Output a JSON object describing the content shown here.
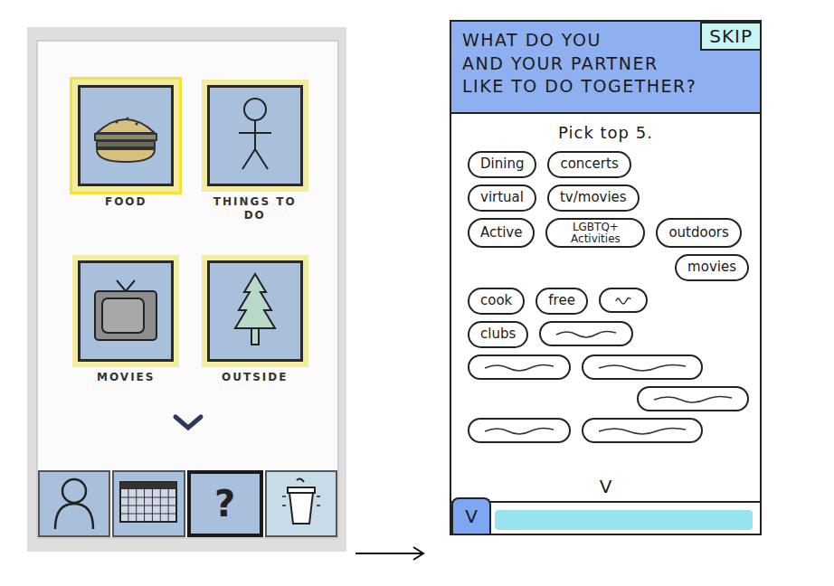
{
  "left": {
    "tiles": [
      {
        "label": "FOOD",
        "kind": "food",
        "selected": true
      },
      {
        "label": "THINGS TO DO",
        "kind": "person",
        "selected": false
      },
      {
        "label": "MOVIES",
        "kind": "tv",
        "selected": false
      },
      {
        "label": "OUTSIDE",
        "kind": "tree",
        "selected": false
      }
    ],
    "nav": [
      {
        "kind": "profile",
        "selected": false
      },
      {
        "kind": "calendar",
        "selected": false
      },
      {
        "kind": "help",
        "label": "?",
        "selected": true
      },
      {
        "kind": "drink",
        "selected": false
      }
    ]
  },
  "right": {
    "title_lines": [
      "WHAT DO YOU",
      "AND YOUR PARTNER",
      "LIKE TO DO TOGETHER?"
    ],
    "skip": "SKIP",
    "instruction": "Pick top 5.",
    "option_rows": [
      [
        {
          "kind": "text",
          "label": "Dining"
        },
        {
          "kind": "text",
          "label": "concerts"
        }
      ],
      [
        {
          "kind": "text",
          "label": "virtual"
        },
        {
          "kind": "text",
          "label": "tv/movies"
        }
      ],
      [
        {
          "kind": "text",
          "label": "Active"
        },
        {
          "kind": "text",
          "label": "LGBTQ+ Activities"
        },
        {
          "kind": "text",
          "label": "outdoors"
        }
      ],
      [
        {
          "kind": "text",
          "label": "movies"
        }
      ],
      [
        {
          "kind": "text",
          "label": "cook"
        },
        {
          "kind": "text",
          "label": "free"
        },
        {
          "kind": "scribble"
        }
      ],
      [
        {
          "kind": "text",
          "label": "clubs"
        },
        {
          "kind": "scribble"
        }
      ],
      [
        {
          "kind": "scribble"
        },
        {
          "kind": "scribble"
        }
      ],
      [
        {
          "kind": "scribble"
        }
      ],
      [
        {
          "kind": "scribble"
        },
        {
          "kind": "scribble"
        }
      ]
    ],
    "more": "V",
    "bottom_tab": "V"
  }
}
